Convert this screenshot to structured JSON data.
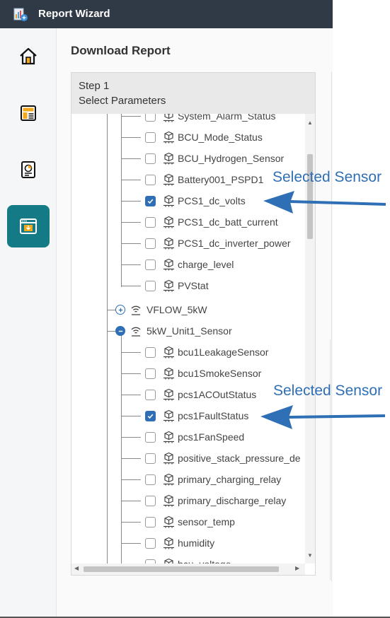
{
  "app": {
    "title": "Report Wizard"
  },
  "sidebar": {
    "items": [
      {
        "name": "home-icon",
        "active": false
      },
      {
        "name": "report-icon",
        "active": false
      },
      {
        "name": "dashboard-icon",
        "active": false
      },
      {
        "name": "download-report-icon",
        "active": true
      }
    ]
  },
  "main": {
    "page_title": "Download Report",
    "step": {
      "number": "Step 1",
      "subtitle": "Select Parameters"
    }
  },
  "tree": {
    "group1_items": [
      {
        "label": "System_Alarm_Status",
        "checked": false
      },
      {
        "label": "BCU_Mode_Status",
        "checked": false
      },
      {
        "label": "BCU_Hydrogen_Sensor",
        "checked": false
      },
      {
        "label": "Battery001_PSPD1",
        "checked": false
      },
      {
        "label": "PCS1_dc_volts",
        "checked": true
      },
      {
        "label": "PCS1_dc_batt_current",
        "checked": false
      },
      {
        "label": "PCS1_dc_inverter_power",
        "checked": false
      },
      {
        "label": "charge_level",
        "checked": false
      },
      {
        "label": "PVStat",
        "checked": false
      }
    ],
    "node_vflow": {
      "label": "VFLOW_5kW",
      "expanded": false
    },
    "node_5kw": {
      "label": "5kW_Unit1_Sensor",
      "expanded": true
    },
    "group2_items": [
      {
        "label": "bcu1LeakageSensor",
        "checked": false
      },
      {
        "label": "bcu1SmokeSensor",
        "checked": false
      },
      {
        "label": "pcs1ACOutStatus",
        "checked": false
      },
      {
        "label": "pcs1FaultStatus",
        "checked": true
      },
      {
        "label": "pcs1FanSpeed",
        "checked": false
      },
      {
        "label": "positive_stack_pressure_de",
        "checked": false
      },
      {
        "label": "primary_charging_relay",
        "checked": false
      },
      {
        "label": "primary_discharge_relay",
        "checked": false
      },
      {
        "label": "sensor_temp",
        "checked": false
      },
      {
        "label": "humidity",
        "checked": false
      },
      {
        "label": "bcu_voltage",
        "checked": false
      }
    ]
  },
  "annotations": [
    {
      "label": "Selected Sensor"
    },
    {
      "label": "Selected Sensor"
    }
  ],
  "colors": {
    "topbar": "#2f3a46",
    "accent_teal": "#137a86",
    "checkbox_blue": "#2f6fb5",
    "annotation_blue": "#2f6fb5"
  }
}
